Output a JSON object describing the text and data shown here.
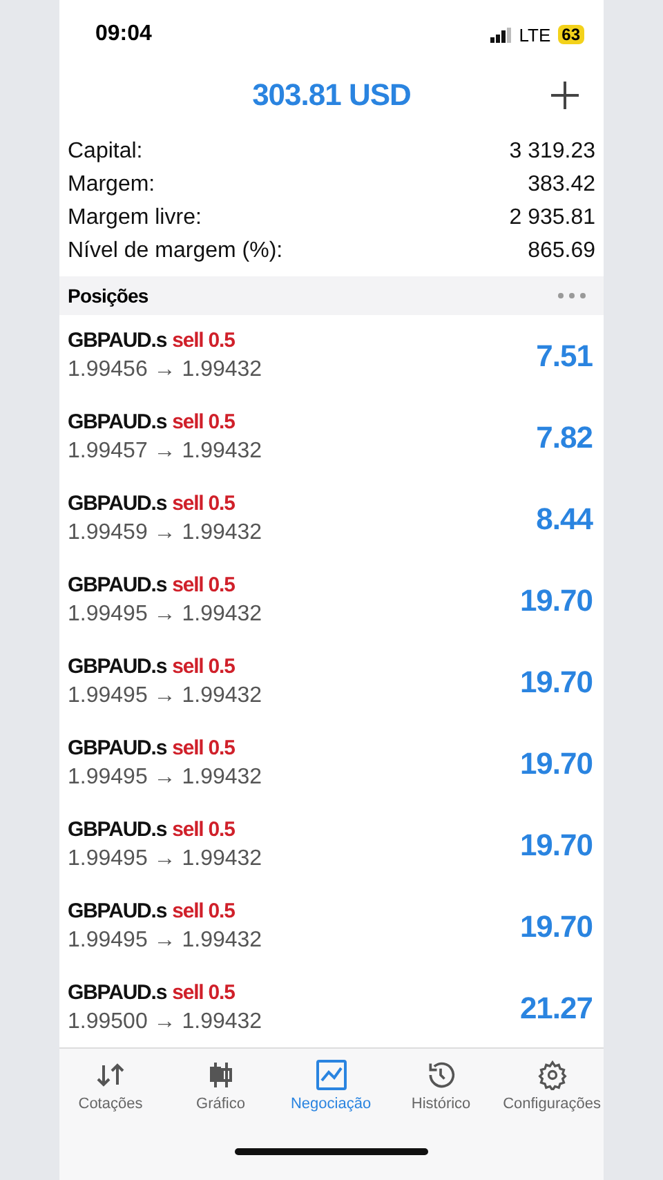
{
  "status_bar": {
    "time": "09:04",
    "network": "LTE",
    "battery": "63"
  },
  "header": {
    "title": "303.81 USD"
  },
  "summary": [
    {
      "label": "Capital:",
      "value": "3 319.23"
    },
    {
      "label": "Margem:",
      "value": "383.42"
    },
    {
      "label": "Margem livre:",
      "value": "2 935.81"
    },
    {
      "label": "Nível de margem (%):",
      "value": "865.69"
    }
  ],
  "section": {
    "title": "Posições"
  },
  "positions": [
    {
      "symbol": "GBPAUD.s",
      "order": "sell 0.5",
      "prices": "1.99456 → 1.99432",
      "profit": "7.51"
    },
    {
      "symbol": "GBPAUD.s",
      "order": "sell 0.5",
      "prices": "1.99457 → 1.99432",
      "profit": "7.82"
    },
    {
      "symbol": "GBPAUD.s",
      "order": "sell 0.5",
      "prices": "1.99459 → 1.99432",
      "profit": "8.44"
    },
    {
      "symbol": "GBPAUD.s",
      "order": "sell 0.5",
      "prices": "1.99495 → 1.99432",
      "profit": "19.70"
    },
    {
      "symbol": "GBPAUD.s",
      "order": "sell 0.5",
      "prices": "1.99495 → 1.99432",
      "profit": "19.70"
    },
    {
      "symbol": "GBPAUD.s",
      "order": "sell 0.5",
      "prices": "1.99495 → 1.99432",
      "profit": "19.70"
    },
    {
      "symbol": "GBPAUD.s",
      "order": "sell 0.5",
      "prices": "1.99495 → 1.99432",
      "profit": "19.70"
    },
    {
      "symbol": "GBPAUD.s",
      "order": "sell 0.5",
      "prices": "1.99495 → 1.99432",
      "profit": "19.70"
    },
    {
      "symbol": "GBPAUD.s",
      "order": "sell 0.5",
      "prices": "1.99500 → 1.99432",
      "profit": "21.27"
    }
  ],
  "tabs": [
    {
      "label": "Cotações",
      "kind": "quotes",
      "selected": false
    },
    {
      "label": "Gráfico",
      "kind": "chart",
      "selected": false
    },
    {
      "label": "Negociação",
      "kind": "trade",
      "selected": true
    },
    {
      "label": "Histórico",
      "kind": "history",
      "selected": false
    },
    {
      "label": "Configurações",
      "kind": "settings",
      "selected": false
    }
  ]
}
